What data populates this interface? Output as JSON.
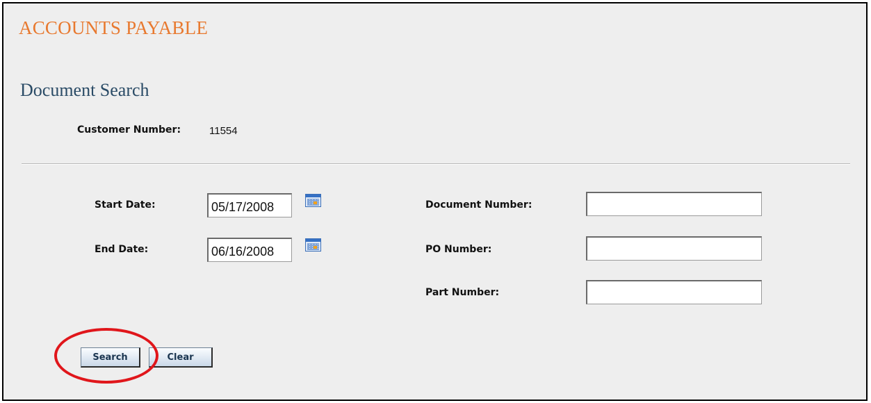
{
  "header": {
    "app_title": "ACCOUNTS PAYABLE"
  },
  "section": {
    "title": "Document Search"
  },
  "customer": {
    "label": "Customer Number:",
    "value": "11554"
  },
  "form": {
    "start_date": {
      "label": "Start Date:",
      "value": "05/17/2008"
    },
    "end_date": {
      "label": "End Date:",
      "value": "06/16/2008"
    },
    "document_number": {
      "label": "Document Number:",
      "value": ""
    },
    "po_number": {
      "label": "PO Number:",
      "value": ""
    },
    "part_number": {
      "label": "Part Number:",
      "value": ""
    }
  },
  "actions": {
    "search_label": "Search",
    "clear_label": "Clear"
  },
  "icons": {
    "calendar": "calendar-icon"
  },
  "colors": {
    "app_title": "#e8792f",
    "section_title": "#2a4b66",
    "highlight": "#e0161b",
    "background": "#eeeeee"
  }
}
